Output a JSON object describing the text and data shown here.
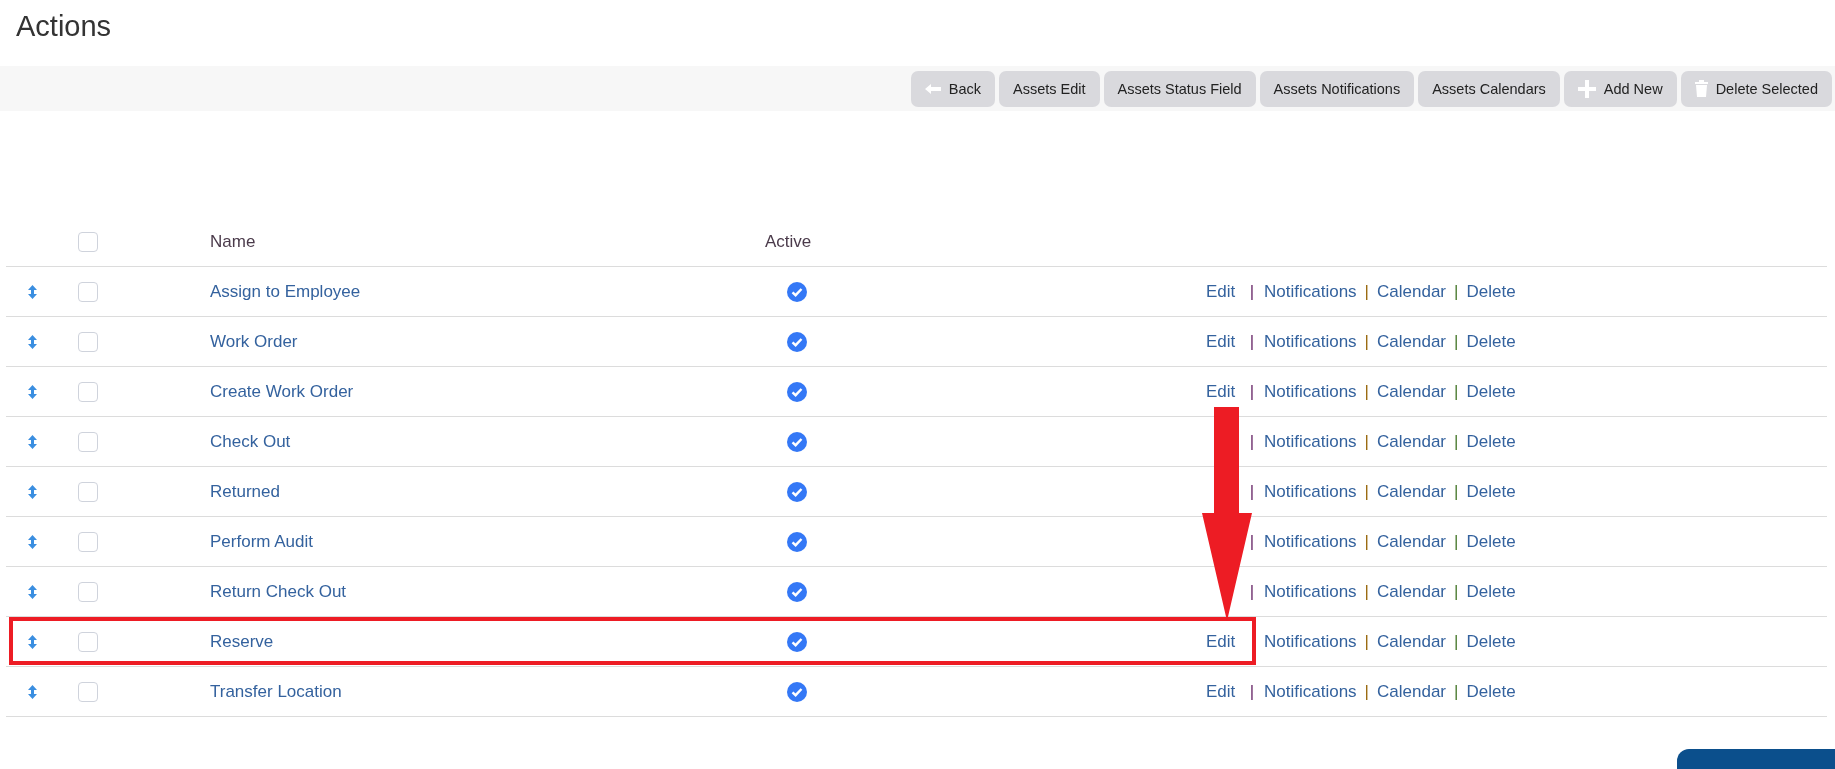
{
  "page_title": "Actions",
  "toolbar": [
    {
      "label": "Back",
      "kind": "back"
    },
    {
      "label": "Assets Edit"
    },
    {
      "label": "Assets Status Field"
    },
    {
      "label": "Assets Notifications"
    },
    {
      "label": "Assets Calendars"
    },
    {
      "label": "Add New",
      "kind": "add"
    },
    {
      "label": "Delete Selected",
      "kind": "delete"
    }
  ],
  "table": {
    "header_checked": false,
    "columns": [
      "Name",
      "Active"
    ],
    "rows": [
      {
        "name": "Assign to Employee",
        "checked": false,
        "active": true,
        "highlighted": false,
        "edit": "Edit",
        "edit_sep": "|",
        "links": [
          {
            "kind": "link",
            "text": "Notifications"
          },
          {
            "kind": "sep",
            "text": "|"
          },
          {
            "kind": "link",
            "text": "Calendar"
          },
          {
            "kind": "sep",
            "text": "|"
          },
          {
            "kind": "link",
            "text": "Delete"
          }
        ]
      },
      {
        "name": "Work Order",
        "checked": false,
        "active": true,
        "highlighted": false,
        "edit": "Edit",
        "edit_sep": "|",
        "links": [
          {
            "kind": "link",
            "text": "Notifications"
          },
          {
            "kind": "sep",
            "text": "|"
          },
          {
            "kind": "link",
            "text": "Calendar"
          },
          {
            "kind": "sep",
            "text": "|"
          },
          {
            "kind": "link",
            "text": "Delete"
          }
        ]
      },
      {
        "name": "Create Work Order",
        "checked": false,
        "active": true,
        "highlighted": false,
        "edit": "Edit",
        "edit_sep": "|",
        "links": [
          {
            "kind": "link",
            "text": "Notifications"
          },
          {
            "kind": "sep",
            "text": "|"
          },
          {
            "kind": "link",
            "text": "Calendar"
          },
          {
            "kind": "sep",
            "text": "|"
          },
          {
            "kind": "link",
            "text": "Delete"
          }
        ]
      },
      {
        "name": "Check Out",
        "checked": false,
        "active": true,
        "highlighted": false,
        "edit_sep": "|",
        "links": [
          {
            "kind": "link",
            "text": "Notifications"
          },
          {
            "kind": "sep",
            "text": "|"
          },
          {
            "kind": "link",
            "text": "Calendar"
          },
          {
            "kind": "sep",
            "text": "|"
          },
          {
            "kind": "link",
            "text": "Delete"
          }
        ]
      },
      {
        "name": "Returned",
        "checked": false,
        "active": true,
        "highlighted": false,
        "edit_sep": "|",
        "links": [
          {
            "kind": "link",
            "text": "Notifications"
          },
          {
            "kind": "sep",
            "text": "|"
          },
          {
            "kind": "link",
            "text": "Calendar"
          },
          {
            "kind": "sep",
            "text": "|"
          },
          {
            "kind": "link",
            "text": "Delete"
          }
        ]
      },
      {
        "name": "Perform Audit",
        "checked": false,
        "active": true,
        "highlighted": false,
        "edit_sep": "|",
        "links": [
          {
            "kind": "link",
            "text": "Notifications"
          },
          {
            "kind": "sep",
            "text": "|"
          },
          {
            "kind": "link",
            "text": "Calendar"
          },
          {
            "kind": "sep",
            "text": "|"
          },
          {
            "kind": "link",
            "text": "Delete"
          }
        ]
      },
      {
        "name": "Return Check Out",
        "checked": false,
        "active": true,
        "highlighted": false,
        "edit_sep": "|",
        "links": [
          {
            "kind": "link",
            "text": "Notifications"
          },
          {
            "kind": "sep",
            "text": "|"
          },
          {
            "kind": "link",
            "text": "Calendar"
          },
          {
            "kind": "sep",
            "text": "|"
          },
          {
            "kind": "link",
            "text": "Delete"
          }
        ]
      },
      {
        "name": "Reserve",
        "checked": false,
        "active": true,
        "highlighted": true,
        "edit": "Edit",
        "links": [
          {
            "kind": "link",
            "text": "Notifications"
          },
          {
            "kind": "sep",
            "text": "|"
          },
          {
            "kind": "link",
            "text": "Calendar"
          },
          {
            "kind": "sep",
            "text": "|"
          },
          {
            "kind": "link",
            "text": "Delete"
          }
        ]
      },
      {
        "name": "Transfer Location",
        "checked": false,
        "active": true,
        "highlighted": false,
        "edit": "Edit",
        "edit_sep": "|",
        "links": [
          {
            "kind": "link",
            "text": "Notifications"
          },
          {
            "kind": "sep",
            "text": "|"
          },
          {
            "kind": "link",
            "text": "Calendar"
          },
          {
            "kind": "sep",
            "text": "|"
          },
          {
            "kind": "link",
            "text": "Delete"
          }
        ]
      }
    ]
  }
}
